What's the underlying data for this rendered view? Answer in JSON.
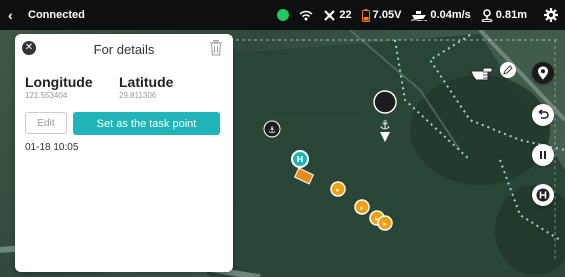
{
  "statusbar": {
    "back_glyph": "‹",
    "connection": "Connected",
    "satellites": "22",
    "voltage": "7.05V",
    "speed": "0.04m/s",
    "distance": "0.81m"
  },
  "details": {
    "title": "For details",
    "longitude_label": "Longitude",
    "longitude_value": "121.553404",
    "latitude_label": "Latitude",
    "latitude_value": "29.811306",
    "edit_label": "Edit",
    "set_task_label": "Set as the task point",
    "timestamp": "01-18 10:05"
  },
  "icons": {
    "back": "chevron-left-icon",
    "gps": "gps-status-icon",
    "wifi": "wifi-icon",
    "satellite": "satellite-icon",
    "battery": "battery-icon",
    "boat": "boat-icon",
    "distance": "location-person-icon",
    "settings": "gear-icon",
    "close": "close-icon",
    "trash": "trash-icon"
  },
  "colors": {
    "accent": "#1fb5b8",
    "gps_ok": "#22c55e",
    "battery": "#f97316",
    "waypoint": "#f59e0b",
    "route": "#9bd7d6"
  }
}
